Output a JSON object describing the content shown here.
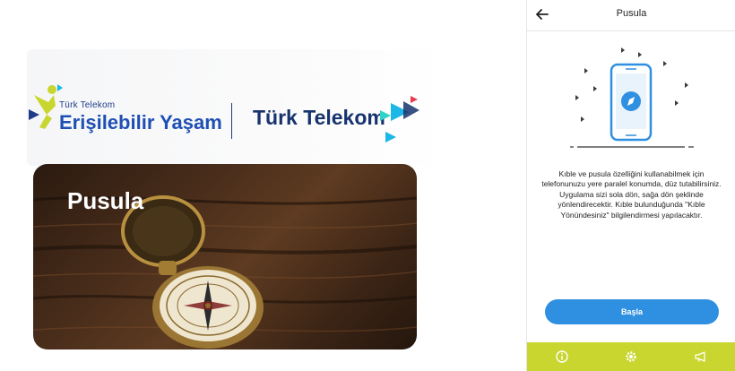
{
  "promo": {
    "brand_small": "Türk Telekom",
    "brand_main": "Erişilebilir Yaşam",
    "brand_right": "Türk Telekom",
    "card_title": "Pusula"
  },
  "phone": {
    "header": {
      "title": "Pusula",
      "back_icon": "arrow-left-icon"
    },
    "description": "Kıble ve pusula özelliğini kullanabilmek için telefonunuzu yere paralel konumda, düz tutabilirsiniz. Uygulama sizi sola dön, sağa dön şeklinde yönlendirecektir. Kıble bulunduğunda \"Kıble Yönündesiniz\" bilgilendirmesi yapılacaktır.",
    "start_button": "Başla",
    "bottom_bar": {
      "color": "#c8d62f",
      "items": [
        {
          "icon": "info-icon"
        },
        {
          "icon": "settings-icon"
        },
        {
          "icon": "megaphone-icon"
        }
      ]
    }
  },
  "colors": {
    "accent_blue": "#2f8fe0",
    "brand_navy": "#17336e",
    "brand_yellow": "#c8d62f",
    "brand_cyan": "#1bb7e6"
  }
}
